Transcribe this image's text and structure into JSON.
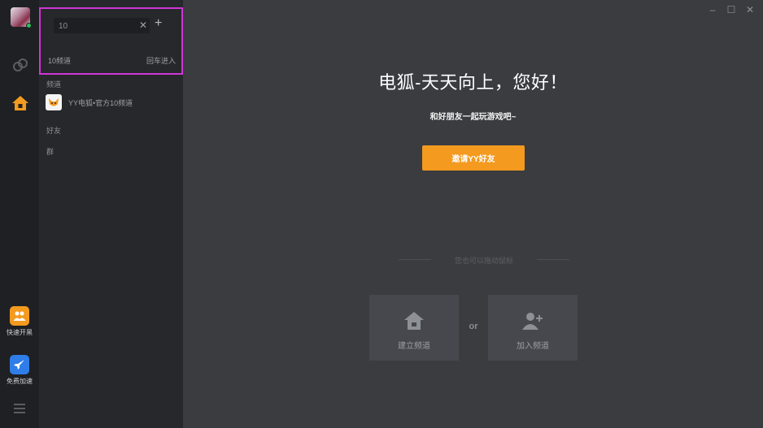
{
  "rail": {
    "avatar_icon": "user-avatar-icon",
    "quick_team_label": "快速开黑",
    "free_boost_label": "免费加速"
  },
  "search": {
    "value": "10",
    "result_name": "10频道",
    "result_action": "回车进入"
  },
  "sections": {
    "channel": "频道",
    "friends": "好友",
    "groups": "群"
  },
  "channels": [
    {
      "name": "YY电狐•官方10频道",
      "icon": "fox-logo-icon"
    }
  ],
  "main": {
    "greeting": "电狐-天天向上，您好！",
    "subtitle": "和好朋友一起玩游戏吧~",
    "invite_button": "邀请YY好友",
    "divider_text": "您也可以拖动鼠标",
    "create_channel": "建立频道",
    "or": "or",
    "join_channel": "加入频道"
  },
  "colors": {
    "accent": "#f39a1f",
    "highlight_border": "#d135d6",
    "boost_blue": "#2f7de8"
  }
}
